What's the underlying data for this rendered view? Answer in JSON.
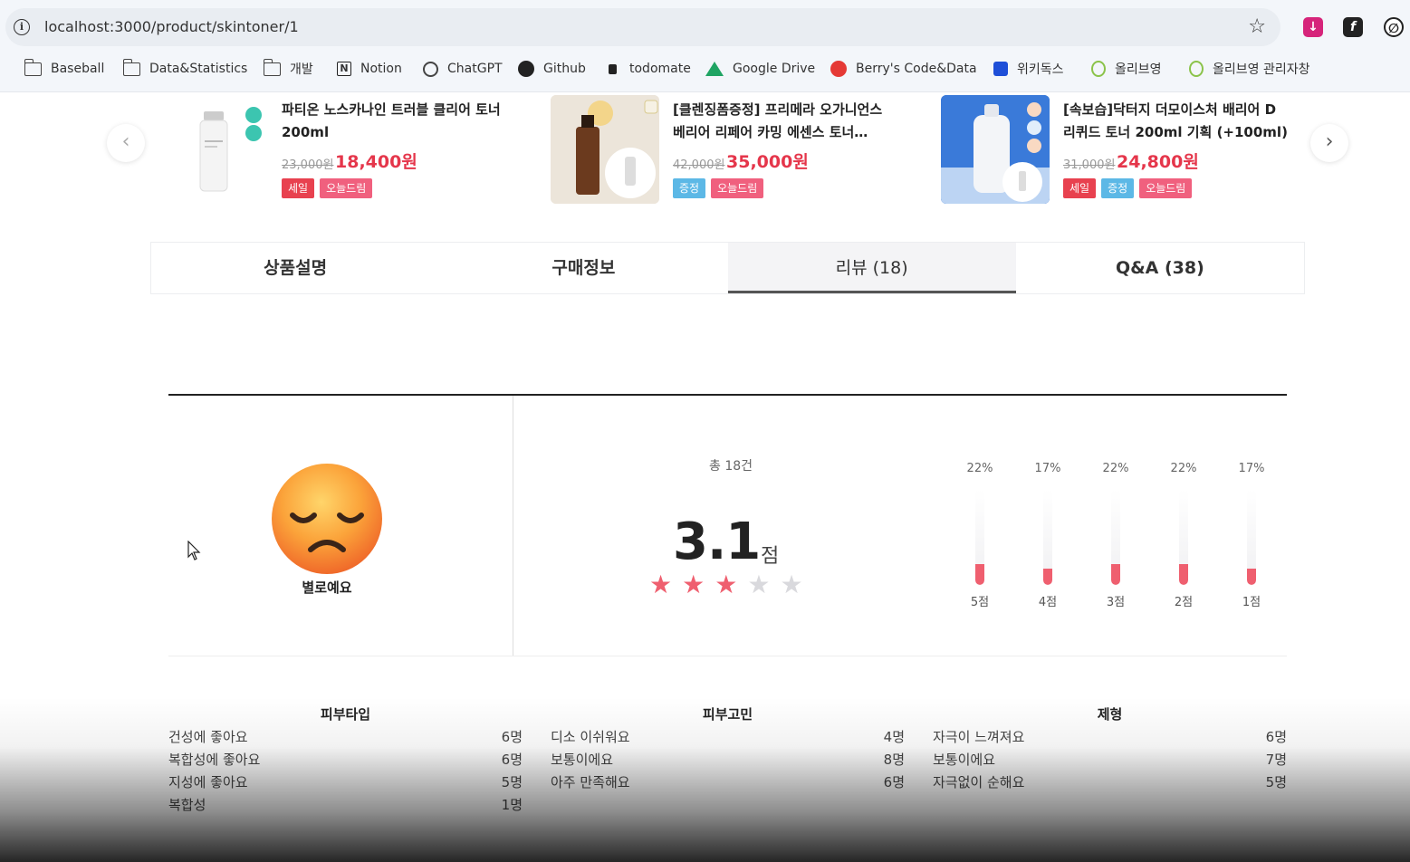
{
  "browser": {
    "url": "localhost:3000/product/skintoner/1",
    "bookmarks": [
      {
        "label": "Baseball",
        "icon": "folder-icon"
      },
      {
        "label": "Data&Statistics",
        "icon": "folder-icon"
      },
      {
        "label": "개발",
        "icon": "folder-icon"
      },
      {
        "label": "Notion",
        "icon": "notion-icon"
      },
      {
        "label": "ChatGPT",
        "icon": "chatgpt-icon"
      },
      {
        "label": "Github",
        "icon": "github-icon"
      },
      {
        "label": "todomate",
        "icon": "todomate-icon"
      },
      {
        "label": "Google Drive",
        "icon": "google-drive-icon"
      },
      {
        "label": "Berry's Code&Data",
        "icon": "berry-icon"
      },
      {
        "label": "위키독스",
        "icon": "wikidocs-icon"
      },
      {
        "label": "올리브영",
        "icon": "oliveyoung-icon"
      },
      {
        "label": "올리브영 관리자창",
        "icon": "oliveyoung-icon"
      }
    ]
  },
  "carousel": {
    "prev_icon": "chevron-left-icon",
    "next_icon": "chevron-right-icon",
    "products": [
      {
        "name": "파티온 노스카나인 트러블 클리어 토너 200ml",
        "original_price": "23,000원",
        "price": "18,400원",
        "badges": [
          {
            "label": "세일",
            "type": "sale"
          },
          {
            "label": "오늘드림",
            "type": "today"
          }
        ]
      },
      {
        "name": "[클렌징폼증정] 프리메라 오가니언스 베리어 리페어 카밍 에센스 토너…",
        "original_price": "42,000원",
        "price": "35,000원",
        "badges": [
          {
            "label": "증정",
            "type": "gift"
          },
          {
            "label": "오늘드림",
            "type": "today"
          }
        ]
      },
      {
        "name": "[속보습]닥터지 더모이스처 배리어 D 리퀴드 토너 200ml 기획 (+100ml)",
        "original_price": "31,000원",
        "price": "24,800원",
        "badges": [
          {
            "label": "세일",
            "type": "sale"
          },
          {
            "label": "증정",
            "type": "gift"
          },
          {
            "label": "오늘드림",
            "type": "today"
          }
        ]
      }
    ]
  },
  "tabs": [
    {
      "label": "상품설명",
      "active": false
    },
    {
      "label": "구매정보",
      "active": false
    },
    {
      "label": "리뷰 (18)",
      "active": true
    },
    {
      "label": "Q&A (38)",
      "active": false
    }
  ],
  "review_summary": {
    "mood_label": "별로예요",
    "mood_icon": "disappointed-face-icon",
    "total": "총 18건",
    "score": "3.1",
    "score_unit": "점",
    "rating": 3,
    "star_max": 5,
    "colors": {
      "star_on": "#ef5f6f",
      "star_off": "#d9d9dd",
      "bar": "#ef5f6f"
    },
    "distribution": [
      {
        "label": "5점",
        "percent": "22%",
        "value": 0.22
      },
      {
        "label": "4점",
        "percent": "17%",
        "value": 0.17
      },
      {
        "label": "3점",
        "percent": "22%",
        "value": 0.22
      },
      {
        "label": "2점",
        "percent": "22%",
        "value": 0.22
      },
      {
        "label": "1점",
        "percent": "17%",
        "value": 0.17
      }
    ]
  },
  "stats": [
    {
      "title": "피부타입",
      "rows": [
        {
          "label": "건성에 좋아요",
          "count": "6명"
        },
        {
          "label": "복합성에 좋아요",
          "count": "6명"
        },
        {
          "label": "지성에 좋아요",
          "count": "5명"
        },
        {
          "label": "복합성",
          "count": "1명"
        }
      ]
    },
    {
      "title": "피부고민",
      "rows": [
        {
          "label": "디소 이쉬워요",
          "count": "4명"
        },
        {
          "label": "보통이에요",
          "count": "8명"
        },
        {
          "label": "아주 만족해요",
          "count": "6명"
        }
      ]
    },
    {
      "title": "제형",
      "rows": [
        {
          "label": "자극이 느껴져요",
          "count": "6명"
        },
        {
          "label": "보통이에요",
          "count": "7명"
        },
        {
          "label": "자극없이 순해요",
          "count": "5명"
        }
      ]
    }
  ]
}
